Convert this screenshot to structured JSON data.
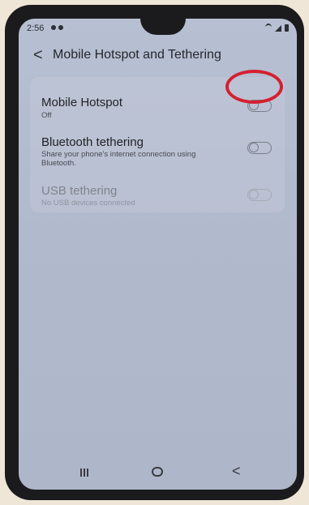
{
  "status_bar": {
    "time": "2:56"
  },
  "header": {
    "back_icon": "chevron-left-icon",
    "back_glyph": "<",
    "title": "Mobile Hotspot and Tethering"
  },
  "settings": [
    {
      "title": "Mobile Hotspot",
      "subtitle": "Off",
      "enabled": true,
      "toggle_on": false
    },
    {
      "title": "Bluetooth tethering",
      "subtitle": "Share your phone's internet connection using Bluetooth.",
      "enabled": true,
      "toggle_on": false
    },
    {
      "title": "USB tethering",
      "subtitle": "No USB devices connected",
      "enabled": false,
      "toggle_on": false
    }
  ],
  "annotation": {
    "highlight_color": "#d4202f",
    "highlights": "settings.0.toggle"
  },
  "nav_bar": {
    "back_glyph": "<"
  },
  "colors": {
    "screen_background": "#b4bcd0",
    "phone_frame": "#1b1b1d",
    "text_primary": "#1f2126",
    "text_disabled": "#80848f"
  }
}
